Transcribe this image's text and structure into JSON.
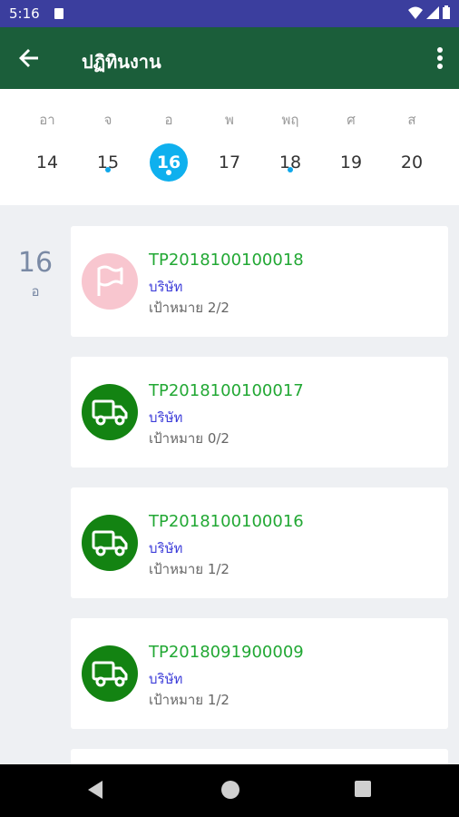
{
  "status_bar": {
    "time": "5:16"
  },
  "app_bar": {
    "title": "ปฏิทินงาน"
  },
  "week": [
    {
      "name": "อา",
      "num": "14",
      "dot": false,
      "selected": false
    },
    {
      "name": "จ",
      "num": "15",
      "dot": true,
      "selected": false
    },
    {
      "name": "อ",
      "num": "16",
      "dot": true,
      "selected": true
    },
    {
      "name": "พ",
      "num": "17",
      "dot": false,
      "selected": false
    },
    {
      "name": "พฤ",
      "num": "18",
      "dot": true,
      "selected": false
    },
    {
      "name": "ศ",
      "num": "19",
      "dot": false,
      "selected": false
    },
    {
      "name": "ส",
      "num": "20",
      "dot": false,
      "selected": false
    }
  ],
  "selected_date": {
    "day": "16",
    "weekday": "อ"
  },
  "tasks": [
    {
      "code": "TP2018100100018",
      "company": "บริษัท",
      "target": "เป้าหมาย 2/2",
      "icon": "flag-icon",
      "color": "#f8c6cf"
    },
    {
      "code": "TP2018100100017",
      "company": "บริษัท",
      "target": "เป้าหมาย 0/2",
      "icon": "truck-icon",
      "color": "#138312"
    },
    {
      "code": "TP2018100100016",
      "company": "บริษัท",
      "target": "เป้าหมาย 1/2",
      "icon": "truck-icon",
      "color": "#138312"
    },
    {
      "code": "TP2018091900009",
      "company": "บริษัท",
      "target": "เป้าหมาย 1/2",
      "icon": "truck-icon",
      "color": "#138312"
    }
  ],
  "colors": {
    "app_bar": "#1b5e3a",
    "status_bar": "#3b3e9e",
    "accent": "#0fb0ee",
    "task_code": "#22a834",
    "company": "#3d3dd9"
  }
}
